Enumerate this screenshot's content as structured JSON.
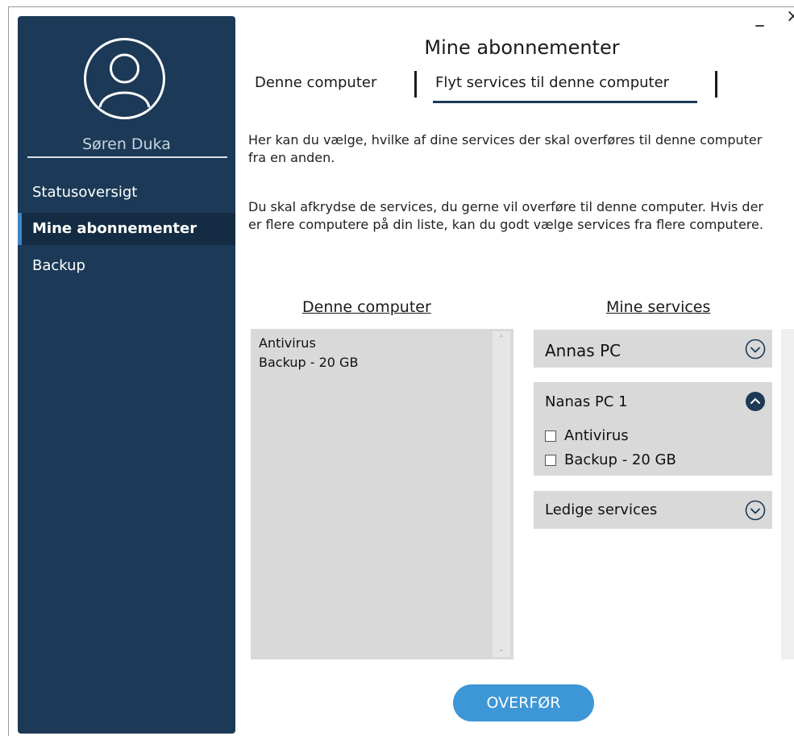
{
  "window": {
    "minimize_label": "–",
    "close_label": "×"
  },
  "sidebar": {
    "user_name": "Søren Duka",
    "avatar_icon": "user-circle-icon",
    "items": [
      {
        "label": "Statusoversigt",
        "active": false
      },
      {
        "label": "Mine abonnementer",
        "active": true
      },
      {
        "label": "Backup",
        "active": false
      }
    ]
  },
  "header": {
    "title": "Mine abonnementer",
    "tabs": [
      {
        "label": "Denne computer",
        "active": false
      },
      {
        "label": "Flyt services til denne computer",
        "active": true
      }
    ]
  },
  "intro": {
    "paragraph1": "Her kan du vælge, hvilke af dine services der skal overføres til denne computer fra en anden.",
    "paragraph2": "Du skal afkrydse de services, du gerne vil overføre til denne computer. Hvis der er flere computere på din liste, kan du godt vælge services fra flere computere."
  },
  "left_panel": {
    "heading": "Denne computer",
    "items": [
      "Antivirus",
      "Backup - 20 GB"
    ]
  },
  "right_panel": {
    "heading": "Mine services",
    "groups": [
      {
        "label": "Annas PC",
        "expanded": false,
        "toggle_icon": "chevron-down-circle-icon"
      },
      {
        "label": "Nanas PC 1",
        "expanded": true,
        "toggle_icon": "chevron-up-circle-filled-icon",
        "services": [
          {
            "label": "Antivirus",
            "checked": false
          },
          {
            "label": "Backup - 20 GB",
            "checked": false
          }
        ]
      },
      {
        "label": "Ledige services",
        "expanded": false,
        "toggle_icon": "chevron-down-circle-icon"
      }
    ]
  },
  "actions": {
    "transfer_label": "OVERFØR"
  },
  "colors": {
    "sidebar_bg": "#1c3a57",
    "active_nav_bg": "#142c43",
    "accent": "#3d96d6",
    "panel_bg": "#d9d9d9"
  }
}
